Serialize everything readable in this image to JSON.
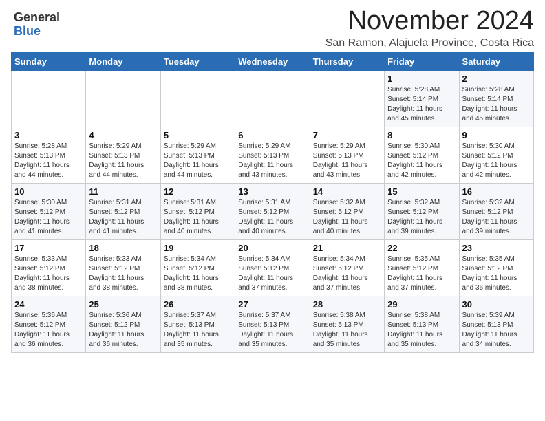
{
  "logo": {
    "general": "General",
    "blue": "Blue"
  },
  "title": "November 2024",
  "location": "San Ramon, Alajuela Province, Costa Rica",
  "days_of_week": [
    "Sunday",
    "Monday",
    "Tuesday",
    "Wednesday",
    "Thursday",
    "Friday",
    "Saturday"
  ],
  "weeks": [
    [
      {
        "day": "",
        "info": ""
      },
      {
        "day": "",
        "info": ""
      },
      {
        "day": "",
        "info": ""
      },
      {
        "day": "",
        "info": ""
      },
      {
        "day": "",
        "info": ""
      },
      {
        "day": "1",
        "info": "Sunrise: 5:28 AM\nSunset: 5:14 PM\nDaylight: 11 hours\nand 45 minutes."
      },
      {
        "day": "2",
        "info": "Sunrise: 5:28 AM\nSunset: 5:14 PM\nDaylight: 11 hours\nand 45 minutes."
      }
    ],
    [
      {
        "day": "3",
        "info": "Sunrise: 5:28 AM\nSunset: 5:13 PM\nDaylight: 11 hours\nand 44 minutes."
      },
      {
        "day": "4",
        "info": "Sunrise: 5:29 AM\nSunset: 5:13 PM\nDaylight: 11 hours\nand 44 minutes."
      },
      {
        "day": "5",
        "info": "Sunrise: 5:29 AM\nSunset: 5:13 PM\nDaylight: 11 hours\nand 44 minutes."
      },
      {
        "day": "6",
        "info": "Sunrise: 5:29 AM\nSunset: 5:13 PM\nDaylight: 11 hours\nand 43 minutes."
      },
      {
        "day": "7",
        "info": "Sunrise: 5:29 AM\nSunset: 5:13 PM\nDaylight: 11 hours\nand 43 minutes."
      },
      {
        "day": "8",
        "info": "Sunrise: 5:30 AM\nSunset: 5:12 PM\nDaylight: 11 hours\nand 42 minutes."
      },
      {
        "day": "9",
        "info": "Sunrise: 5:30 AM\nSunset: 5:12 PM\nDaylight: 11 hours\nand 42 minutes."
      }
    ],
    [
      {
        "day": "10",
        "info": "Sunrise: 5:30 AM\nSunset: 5:12 PM\nDaylight: 11 hours\nand 41 minutes."
      },
      {
        "day": "11",
        "info": "Sunrise: 5:31 AM\nSunset: 5:12 PM\nDaylight: 11 hours\nand 41 minutes."
      },
      {
        "day": "12",
        "info": "Sunrise: 5:31 AM\nSunset: 5:12 PM\nDaylight: 11 hours\nand 40 minutes."
      },
      {
        "day": "13",
        "info": "Sunrise: 5:31 AM\nSunset: 5:12 PM\nDaylight: 11 hours\nand 40 minutes."
      },
      {
        "day": "14",
        "info": "Sunrise: 5:32 AM\nSunset: 5:12 PM\nDaylight: 11 hours\nand 40 minutes."
      },
      {
        "day": "15",
        "info": "Sunrise: 5:32 AM\nSunset: 5:12 PM\nDaylight: 11 hours\nand 39 minutes."
      },
      {
        "day": "16",
        "info": "Sunrise: 5:32 AM\nSunset: 5:12 PM\nDaylight: 11 hours\nand 39 minutes."
      }
    ],
    [
      {
        "day": "17",
        "info": "Sunrise: 5:33 AM\nSunset: 5:12 PM\nDaylight: 11 hours\nand 38 minutes."
      },
      {
        "day": "18",
        "info": "Sunrise: 5:33 AM\nSunset: 5:12 PM\nDaylight: 11 hours\nand 38 minutes."
      },
      {
        "day": "19",
        "info": "Sunrise: 5:34 AM\nSunset: 5:12 PM\nDaylight: 11 hours\nand 38 minutes."
      },
      {
        "day": "20",
        "info": "Sunrise: 5:34 AM\nSunset: 5:12 PM\nDaylight: 11 hours\nand 37 minutes."
      },
      {
        "day": "21",
        "info": "Sunrise: 5:34 AM\nSunset: 5:12 PM\nDaylight: 11 hours\nand 37 minutes."
      },
      {
        "day": "22",
        "info": "Sunrise: 5:35 AM\nSunset: 5:12 PM\nDaylight: 11 hours\nand 37 minutes."
      },
      {
        "day": "23",
        "info": "Sunrise: 5:35 AM\nSunset: 5:12 PM\nDaylight: 11 hours\nand 36 minutes."
      }
    ],
    [
      {
        "day": "24",
        "info": "Sunrise: 5:36 AM\nSunset: 5:12 PM\nDaylight: 11 hours\nand 36 minutes."
      },
      {
        "day": "25",
        "info": "Sunrise: 5:36 AM\nSunset: 5:12 PM\nDaylight: 11 hours\nand 36 minutes."
      },
      {
        "day": "26",
        "info": "Sunrise: 5:37 AM\nSunset: 5:13 PM\nDaylight: 11 hours\nand 35 minutes."
      },
      {
        "day": "27",
        "info": "Sunrise: 5:37 AM\nSunset: 5:13 PM\nDaylight: 11 hours\nand 35 minutes."
      },
      {
        "day": "28",
        "info": "Sunrise: 5:38 AM\nSunset: 5:13 PM\nDaylight: 11 hours\nand 35 minutes."
      },
      {
        "day": "29",
        "info": "Sunrise: 5:38 AM\nSunset: 5:13 PM\nDaylight: 11 hours\nand 35 minutes."
      },
      {
        "day": "30",
        "info": "Sunrise: 5:39 AM\nSunset: 5:13 PM\nDaylight: 11 hours\nand 34 minutes."
      }
    ]
  ]
}
